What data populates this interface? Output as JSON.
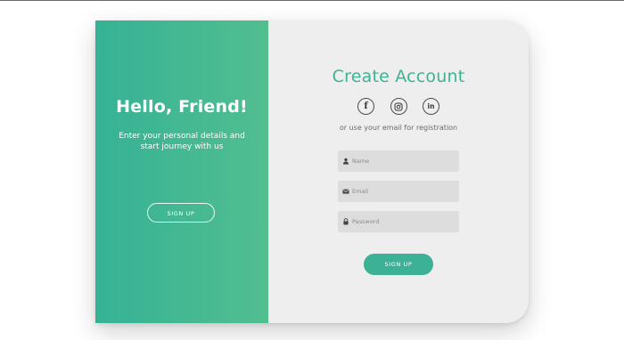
{
  "overlay": {
    "title": "Hello, Friend!",
    "message": "Enter your personal details and start journey with us",
    "button_label": "SIGN UP"
  },
  "form": {
    "title": "Create Account",
    "social": [
      {
        "icon": "facebook-icon",
        "glyph": "f"
      },
      {
        "icon": "instagram-icon",
        "glyph": ""
      },
      {
        "icon": "linkedin-icon",
        "glyph": "in"
      }
    ],
    "hint": "or use your email for registration",
    "fields": {
      "name": {
        "placeholder": "Name",
        "icon": "user-icon"
      },
      "email": {
        "placeholder": "Email",
        "icon": "envelope-icon"
      },
      "password": {
        "placeholder": "Password",
        "icon": "lock-icon"
      }
    },
    "submit_label": "SIGN UP"
  },
  "colors": {
    "accent": "#3db196",
    "gradient_start": "#35b295",
    "gradient_end": "#52be90",
    "panel_bg": "#eeeeee",
    "input_bg": "#dddddd"
  }
}
